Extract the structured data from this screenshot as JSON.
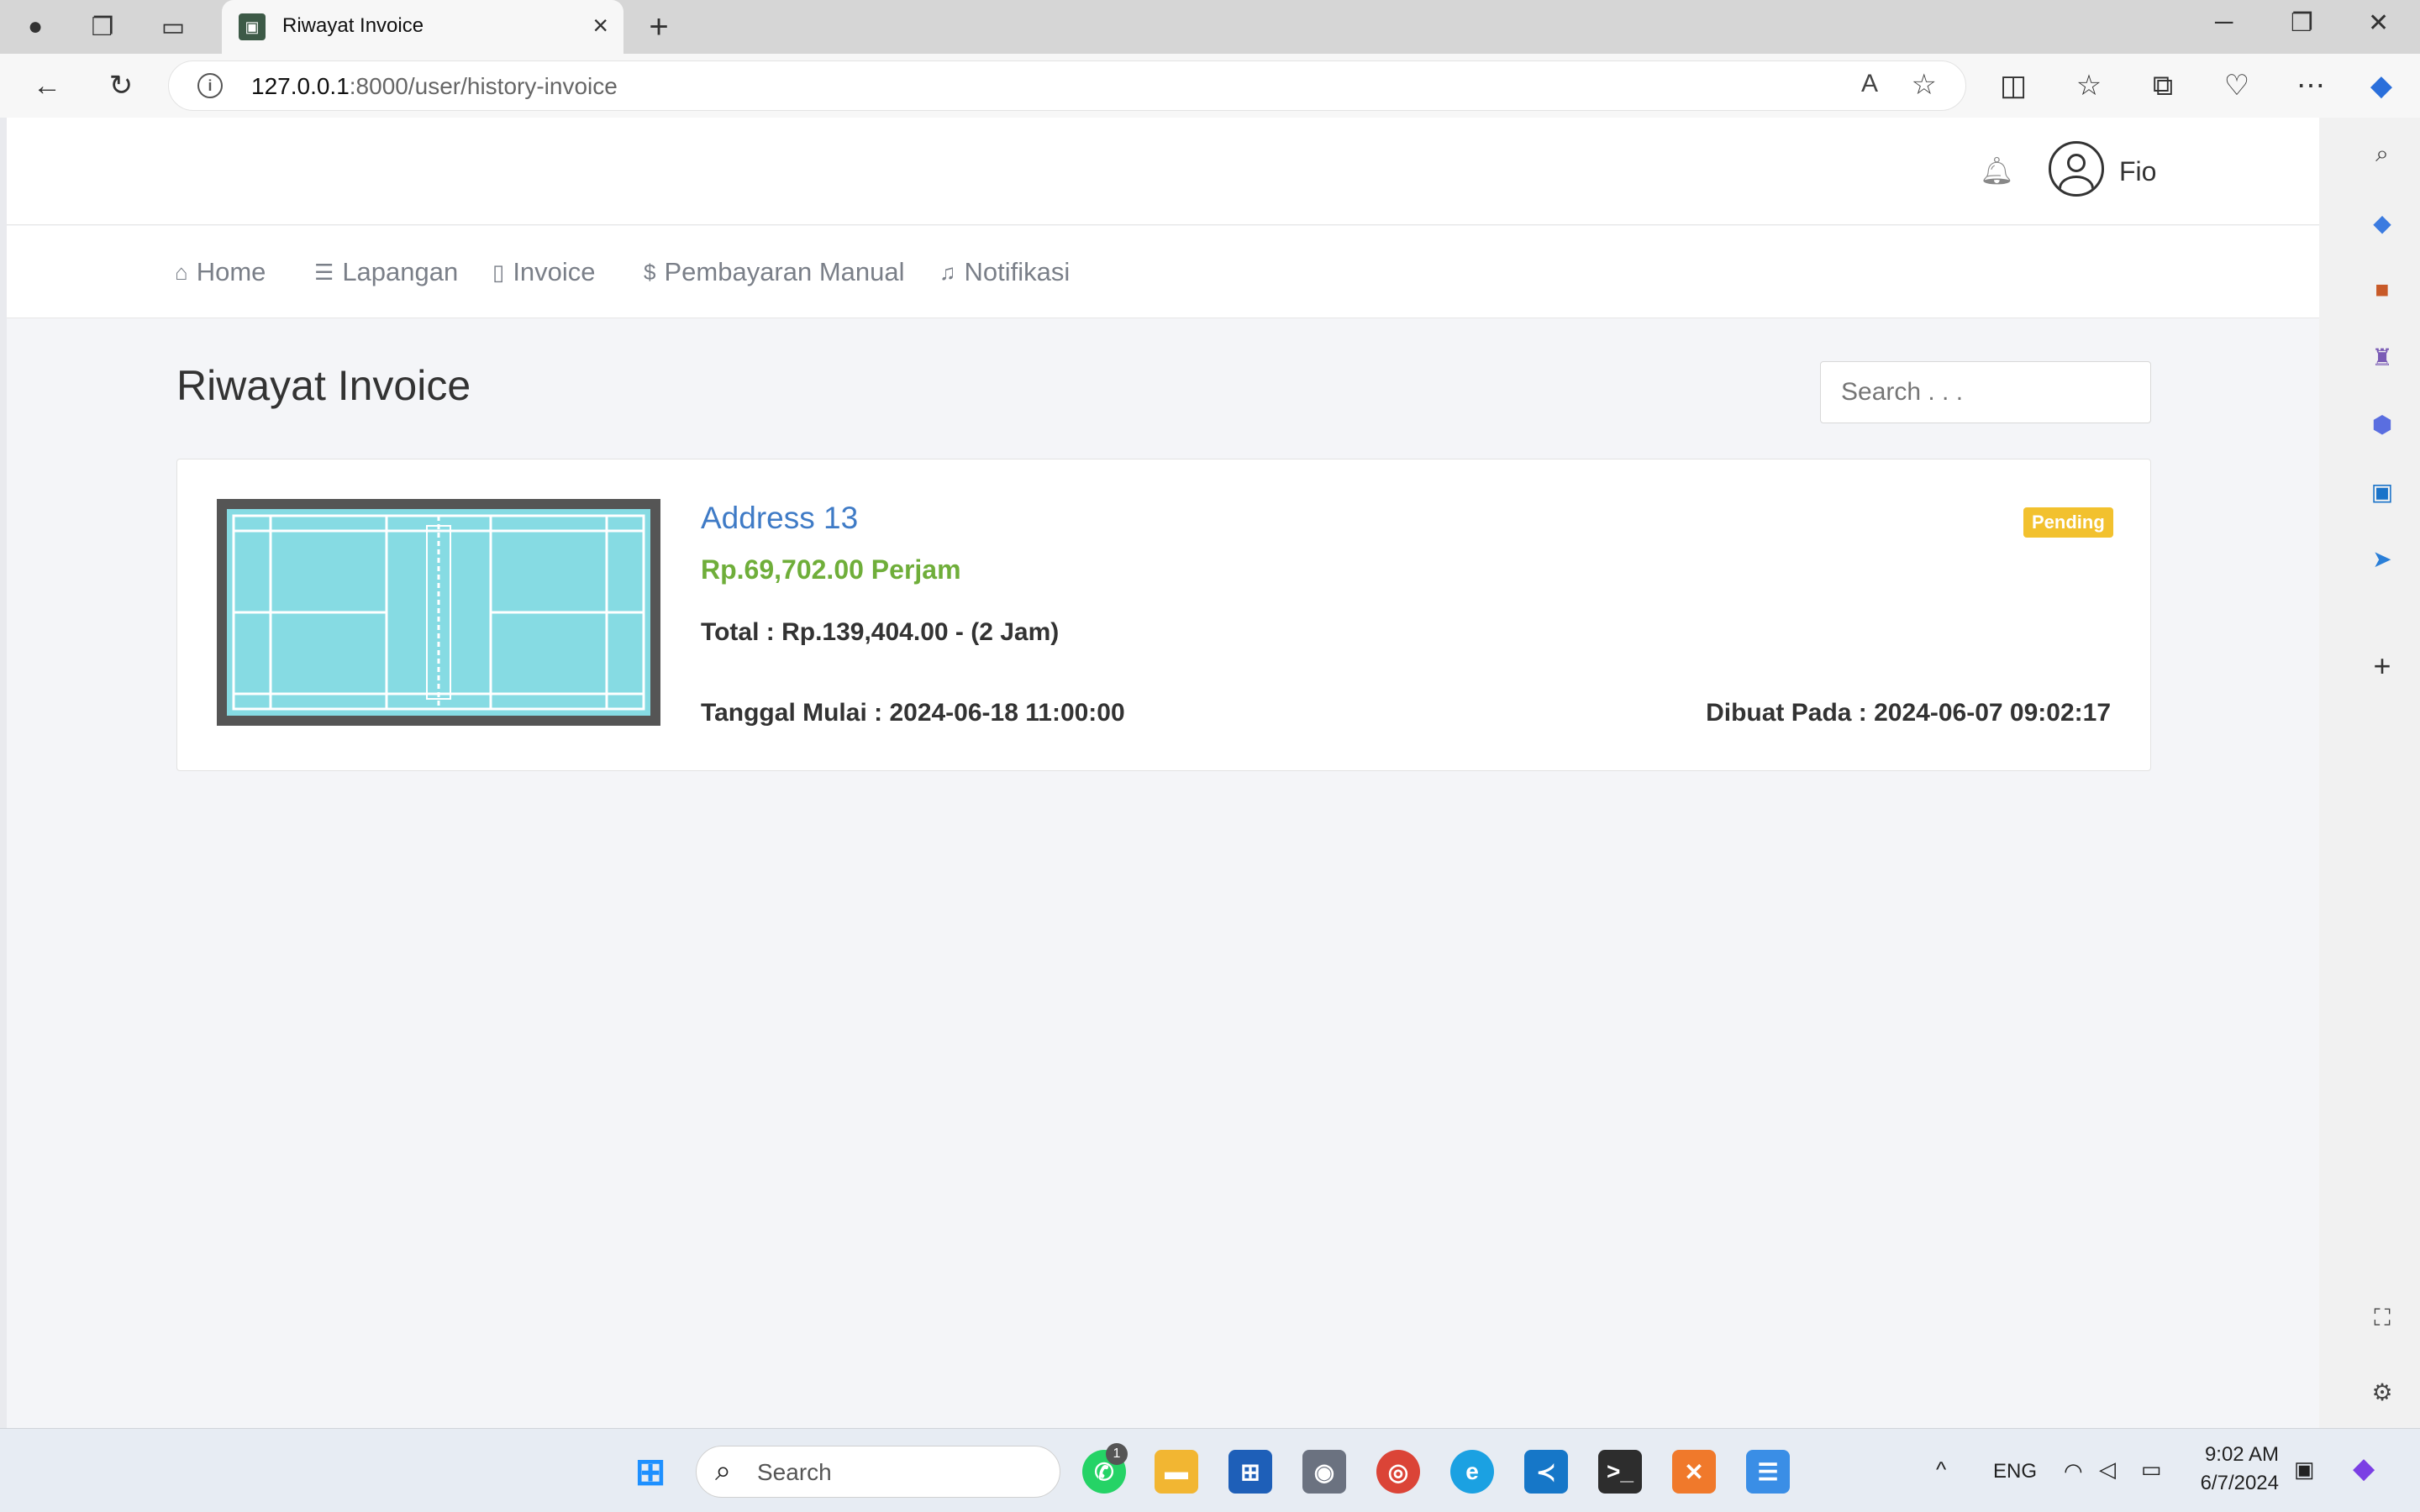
{
  "browser": {
    "tab_title": "Riwayat Invoice",
    "url_host": "127.0.0.1",
    "url_rest": ":8000/user/history-invoice"
  },
  "header": {
    "username": "Fio"
  },
  "menu": [
    {
      "label": "Home",
      "icon": "inbox-icon"
    },
    {
      "label": "Lapangan",
      "icon": "list-icon"
    },
    {
      "label": "Invoice",
      "icon": "clipboard-icon"
    },
    {
      "label": "Pembayaran Manual",
      "icon": "dollar-icon"
    },
    {
      "label": "Notifikasi",
      "icon": "bell-icon"
    }
  ],
  "main": {
    "title": "Riwayat Invoice",
    "search_placeholder": "Search . . ."
  },
  "invoice": {
    "title": "Address 13",
    "price": "Rp.69,702.00 Perjam",
    "total": "Total : Rp.139,404.00 - (2 Jam)",
    "start": "Tanggal Mulai : 2024-06-18 11:00:00",
    "created": "Dibuat Pada : 2024-06-07 09:02:17",
    "status": "Pending",
    "status_color": "#f2c12e"
  },
  "taskbar": {
    "search_label": "Search",
    "whatsapp_badge": "1",
    "lang": "ENG",
    "time": "9:02 AM",
    "date": "6/7/2024"
  }
}
